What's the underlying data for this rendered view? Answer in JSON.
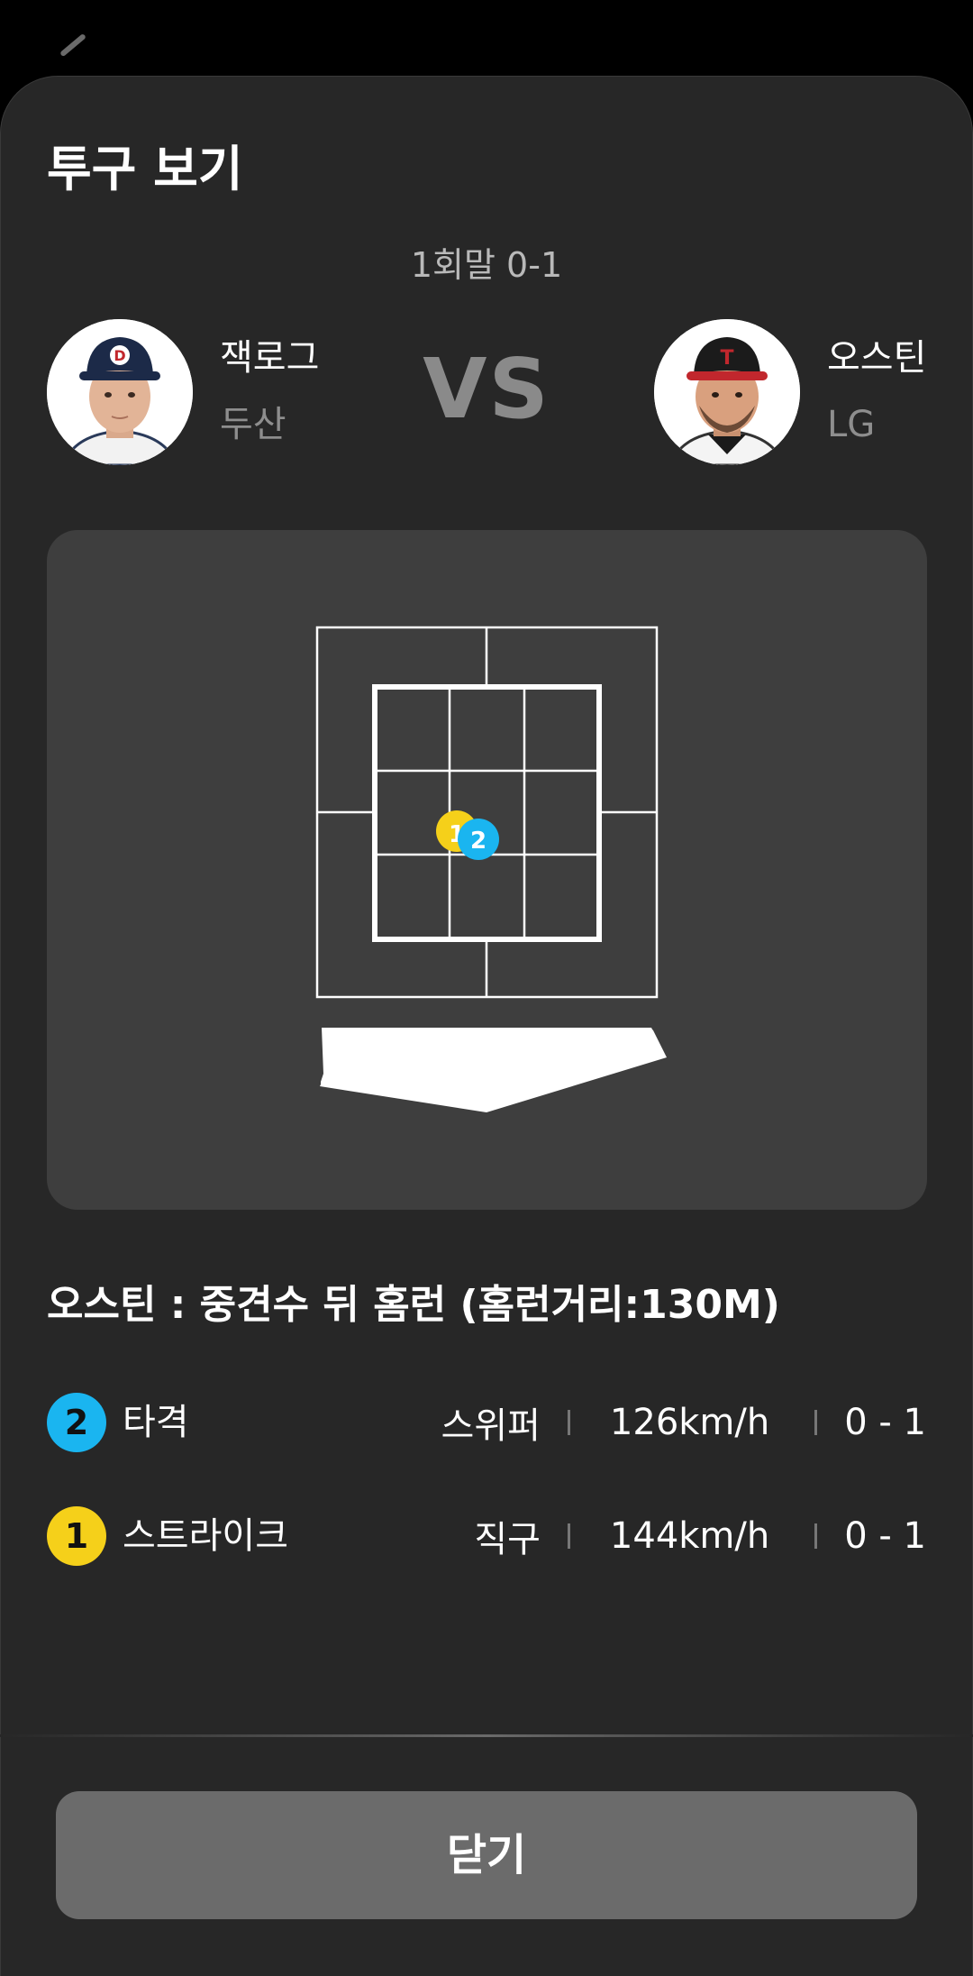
{
  "title": "투구 보기",
  "inning": "1회말 0-1",
  "vs_label": "VS",
  "pitcher": {
    "name": "잭로그",
    "team": "두산"
  },
  "batter": {
    "name": "오스틴",
    "team": "LG"
  },
  "result_text": "오스틴 : 중견수 뒤 홈런 (홈런거리:130M)",
  "pitches": [
    {
      "number": "2",
      "result": "타격",
      "pitch_type": "스위퍼",
      "speed": "126km/h",
      "count": "0 - 1",
      "color": "#1ab5f0"
    },
    {
      "number": "1",
      "result": "스트라이크",
      "pitch_type": "직구",
      "speed": "144km/h",
      "count": "0 - 1",
      "color": "#f5d01a"
    }
  ],
  "close_label": "닫기",
  "icons": {
    "pitcher_photo": "player-photo-icon",
    "batter_photo": "player-photo-icon"
  },
  "colors": {
    "background": "#272727",
    "zone_panel": "#3e3e3e",
    "button": "#6b6b6b"
  }
}
